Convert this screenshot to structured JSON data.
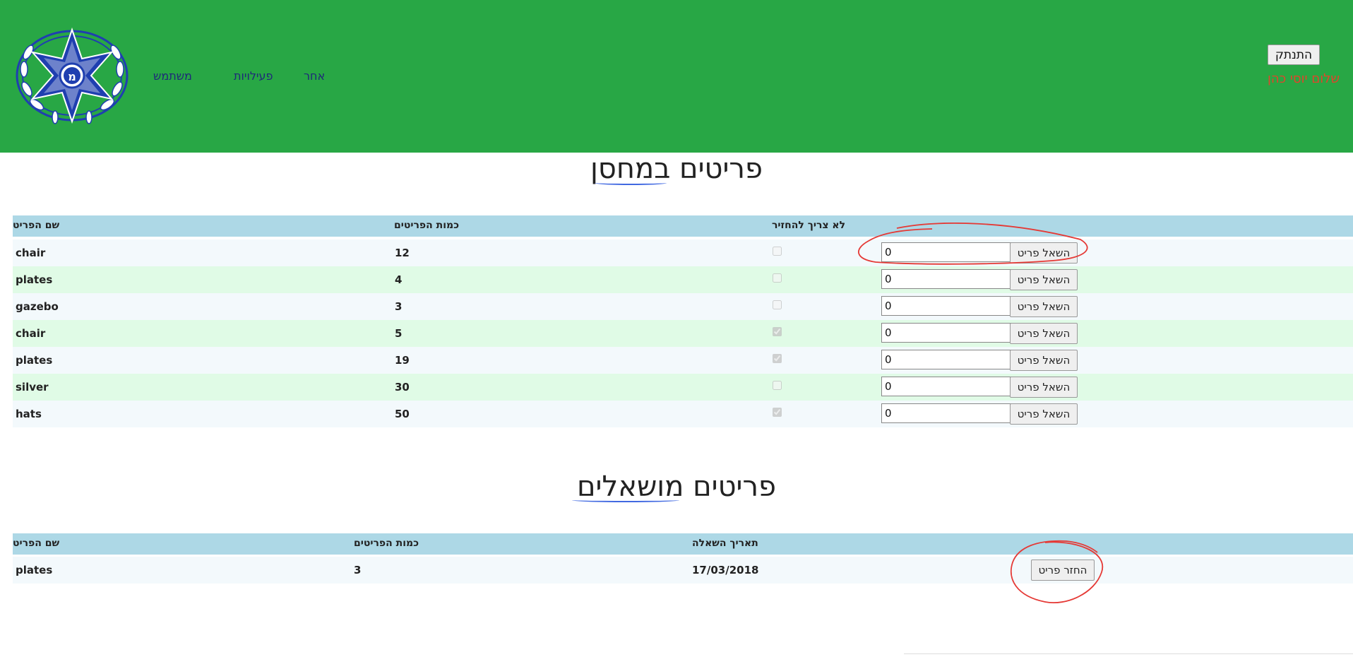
{
  "header": {
    "nav": [
      "משתמש",
      "פעילויות",
      "אחר"
    ],
    "logout_label": "התנתק",
    "greeting": "שלום יוסי כהן",
    "colors": {
      "background": "#28a745",
      "greeting": "#e0452b",
      "nav": "#1e2a78"
    }
  },
  "warehouse": {
    "title": "פריטים במחסן",
    "headers": [
      "שם הפריט",
      "כמות הפריטים",
      "לא צריך להחזיר"
    ],
    "borrow_label": "השאל פריט",
    "rows": [
      {
        "name": "chair",
        "quantity": "12",
        "no_return": false,
        "input": "0"
      },
      {
        "name": "plates",
        "quantity": "4",
        "no_return": false,
        "input": "0"
      },
      {
        "name": "gazebo",
        "quantity": "3",
        "no_return": false,
        "input": "0"
      },
      {
        "name": "chair",
        "quantity": "5",
        "no_return": true,
        "input": "0"
      },
      {
        "name": "plates",
        "quantity": "19",
        "no_return": true,
        "input": "0"
      },
      {
        "name": "silver",
        "quantity": "30",
        "no_return": false,
        "input": "0"
      },
      {
        "name": "hats",
        "quantity": "50",
        "no_return": true,
        "input": "0"
      }
    ]
  },
  "borrowed": {
    "title": "פריטים מושאלים",
    "headers": [
      "שם הפריט",
      "כמות הפריטים",
      "תאריך השאלה"
    ],
    "return_label": "החזר פריט",
    "rows": [
      {
        "name": "plates",
        "quantity": "3",
        "date": "17/03/2018"
      }
    ]
  },
  "colors": {
    "table_header": "#add8e6",
    "row_a": "#f3f9fc",
    "row_b": "#e0fbe6",
    "annotation": "#e53935"
  }
}
